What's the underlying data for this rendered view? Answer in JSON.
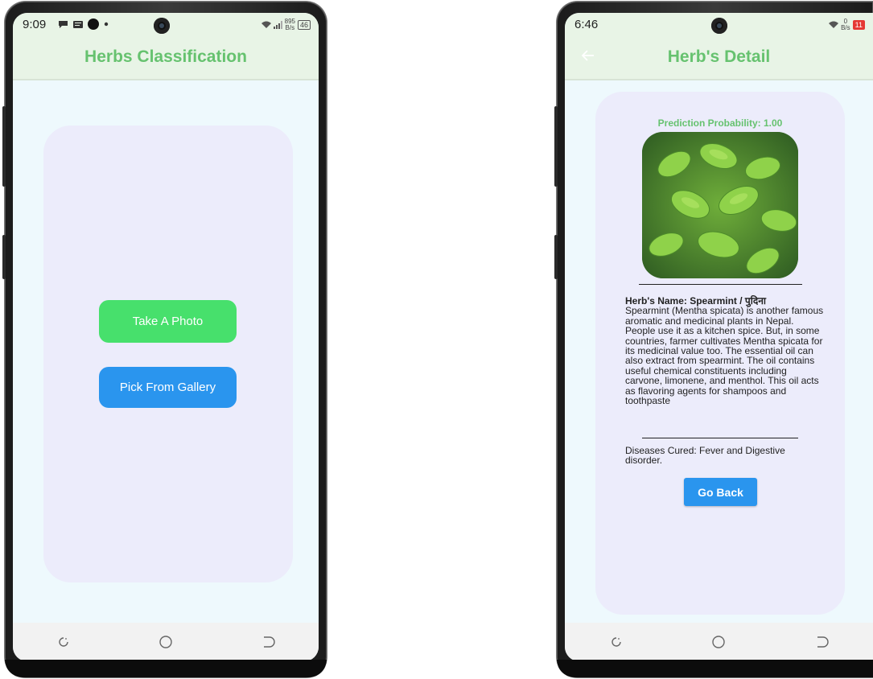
{
  "left_phone": {
    "status": {
      "time": "9:09",
      "network_speed": "895",
      "network_unit": "B/s",
      "battery": "46"
    },
    "appbar_title": "Herbs Classification",
    "buttons": {
      "take_photo": "Take A Photo",
      "pick_gallery": "Pick From Gallery"
    },
    "colors": {
      "title": "#66c26f",
      "take_photo_bg": "#47e06c",
      "pick_gallery_bg": "#2a95ee",
      "card_bg": "#ececfb"
    }
  },
  "right_phone": {
    "status": {
      "time": "6:46",
      "network_speed": "0",
      "network_unit": "B/s",
      "battery": "11"
    },
    "appbar_title": "Herb's Detail",
    "prediction": "Prediction Probability: 1.00",
    "herb_name": "Herb's Name: Spearmint / पुदिना",
    "description": "Spearmint (Mentha spicata) is another famous aromatic and medicinal plants in Nepal. People use it as a kitchen spice. But, in some countries, farmer cultivates Mentha spicata for its medicinal value too. The essential oil can also extract from spearmint. The oil contains useful chemical constituents including carvone, limonene, and menthol. This oil acts as flavoring agents for shampoos and toothpaste",
    "diseases": "Diseases Cured: Fever and Digestive disorder.",
    "go_back": "Go Back",
    "colors": {
      "title": "#66c26f",
      "button_bg": "#2a95ee",
      "battery_low": "#e53935"
    }
  },
  "icons": {
    "back": "arrow-left-icon",
    "nav_recent": "recent-apps-icon",
    "nav_home": "home-icon",
    "nav_back": "back-icon"
  }
}
